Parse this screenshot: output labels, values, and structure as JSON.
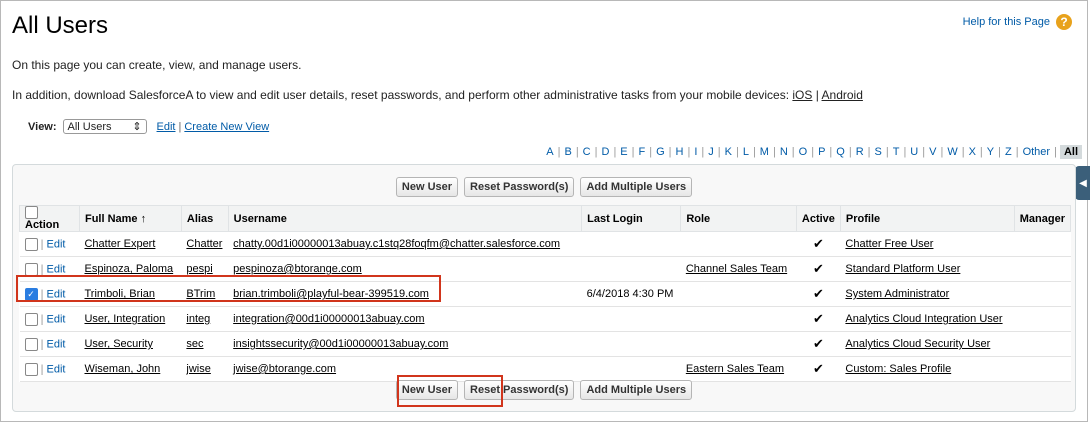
{
  "page": {
    "title": "All Users",
    "help_text": "Help for this Page",
    "intro": "On this page you can create, view, and manage users.",
    "intro2_prefix": "In addition, download SalesforceA to view and edit user details, reset passwords, and perform other administrative tasks from your mobile devices: ",
    "ios": "iOS",
    "sep": " | ",
    "android": "Android"
  },
  "view": {
    "label": "View:",
    "selected": "All Users",
    "edit": "Edit",
    "sep": "|",
    "create": "Create New View"
  },
  "alpha": [
    "A",
    "B",
    "C",
    "D",
    "E",
    "F",
    "G",
    "H",
    "I",
    "J",
    "K",
    "L",
    "M",
    "N",
    "O",
    "P",
    "Q",
    "R",
    "S",
    "T",
    "U",
    "V",
    "W",
    "X",
    "Y",
    "Z",
    "Other"
  ],
  "alpha_all": "All",
  "buttons": {
    "new_user": "New User",
    "reset_password": "Reset Password(s)",
    "add_multiple": "Add Multiple Users"
  },
  "table": {
    "headers": {
      "action": "Action",
      "full_name": "Full Name",
      "sort_icon": "↑",
      "alias": "Alias",
      "username": "Username",
      "last_login": "Last Login",
      "role": "Role",
      "active": "Active",
      "profile": "Profile",
      "manager": "Manager"
    },
    "edit_label": "Edit",
    "row_sep": "|",
    "rows": [
      {
        "checked": false,
        "name": "Chatter Expert",
        "alias": "Chatter",
        "username": "chatty.00d1i00000013abuay.c1stq28foqfm@chatter.salesforce.com",
        "last_login": "",
        "role": "",
        "active": "✔",
        "profile": "Chatter Free User"
      },
      {
        "checked": false,
        "name": "Espinoza, Paloma",
        "alias": "pespi",
        "username": "pespinoza@btorange.com",
        "last_login": "",
        "role": "Channel Sales Team",
        "active": "✔",
        "profile": "Standard Platform User"
      },
      {
        "checked": true,
        "name": "Trimboli, Brian",
        "alias": "BTrim",
        "username": "brian.trimboli@playful-bear-399519.com",
        "last_login": "6/4/2018 4:30 PM",
        "role": "",
        "active": "✔",
        "profile": "System Administrator"
      },
      {
        "checked": false,
        "name": "User, Integration",
        "alias": "integ",
        "username": "integration@00d1i00000013abuay.com",
        "last_login": "",
        "role": "",
        "active": "✔",
        "profile": "Analytics Cloud Integration User"
      },
      {
        "checked": false,
        "name": "User, Security",
        "alias": "sec",
        "username": "insightssecurity@00d1i00000013abuay.com",
        "last_login": "",
        "role": "",
        "active": "✔",
        "profile": "Analytics Cloud Security User"
      },
      {
        "checked": false,
        "name": "Wiseman, John",
        "alias": "jwise",
        "username": "jwise@btorange.com",
        "last_login": "",
        "role": "Eastern Sales Team",
        "active": "✔",
        "profile": "Custom: Sales Profile"
      }
    ]
  },
  "colors": {
    "link": "#015ba7",
    "highlight": "#d1351c"
  }
}
